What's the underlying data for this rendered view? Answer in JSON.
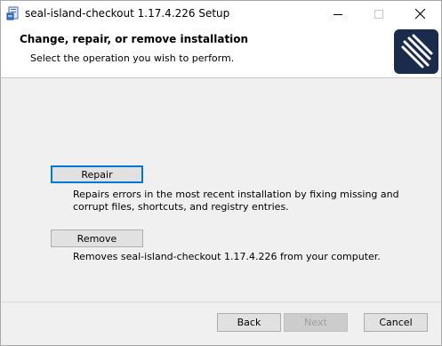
{
  "window": {
    "title": "seal-island-checkout 1.17.4.226 Setup",
    "icons": {
      "app": "installer-icon",
      "minimize": "minimize-icon",
      "maximize": "maximize-icon",
      "close": "close-icon"
    }
  },
  "header": {
    "heading": "Change, repair, or remove installation",
    "subheading": "Select the operation you wish to perform.",
    "logo_icon": "app-logo-icon",
    "logo_color": "#1b2b4b"
  },
  "options": {
    "repair": {
      "label": "Repair",
      "description": "Repairs errors in the most recent installation by fixing missing and corrupt files, shortcuts, and registry entries."
    },
    "remove": {
      "label": "Remove",
      "description": "Removes seal-island-checkout 1.17.4.226 from your computer."
    }
  },
  "footer": {
    "back_label": "Back",
    "next_label": "Next",
    "cancel_label": "Cancel"
  }
}
